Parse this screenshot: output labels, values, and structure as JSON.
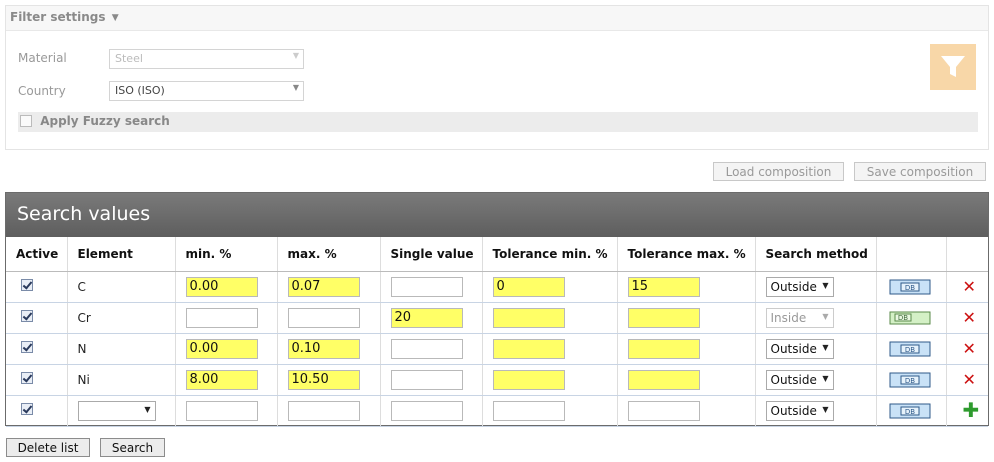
{
  "filter": {
    "header": "Filter settings",
    "material_label": "Material",
    "material_value": "Steel",
    "country_label": "Country",
    "country_value": "ISO (ISO)",
    "fuzzy_label": "Apply Fuzzy search",
    "fuzzy_checked": false,
    "filter_button_icon": "funnel-icon"
  },
  "composition": {
    "load_label": "Load composition",
    "save_label": "Save composition"
  },
  "search_values": {
    "title": "Search values",
    "columns": [
      "Active",
      "Element",
      "min. %",
      "max. %",
      "Single value",
      "Tolerance min. %",
      "Tolerance max. %",
      "Search method",
      "",
      ""
    ],
    "rows": [
      {
        "active": true,
        "element": "C",
        "min": "0.00",
        "max": "0.07",
        "single": "",
        "tol_min": "0",
        "tol_max": "15",
        "method": "Outside",
        "method_disabled": false,
        "action": "delete"
      },
      {
        "active": true,
        "element": "Cr",
        "min": "",
        "max": "",
        "single": "20",
        "tol_min": "",
        "tol_max": "",
        "method": "Inside",
        "method_disabled": true,
        "action": "delete"
      },
      {
        "active": true,
        "element": "N",
        "min": "0.00",
        "max": "0.10",
        "single": "",
        "tol_min": "",
        "tol_max": "",
        "method": "Outside",
        "method_disabled": false,
        "action": "delete"
      },
      {
        "active": true,
        "element": "Ni",
        "min": "8.00",
        "max": "10.50",
        "single": "",
        "tol_min": "",
        "tol_max": "",
        "method": "Outside",
        "method_disabled": false,
        "action": "delete"
      },
      {
        "active": true,
        "element": "",
        "min": "",
        "max": "",
        "single": "",
        "tol_min": "",
        "tol_max": "",
        "method": "Outside",
        "method_disabled": false,
        "action": "add"
      }
    ]
  },
  "footer": {
    "delete_list_label": "Delete list",
    "search_label": "Search"
  },
  "colors": {
    "highlight": "#ffff66",
    "header_bar": "#6b6b6b",
    "filter_button": "#f8d7a8",
    "delete": "#cc1111",
    "add": "#2e9b2e"
  }
}
